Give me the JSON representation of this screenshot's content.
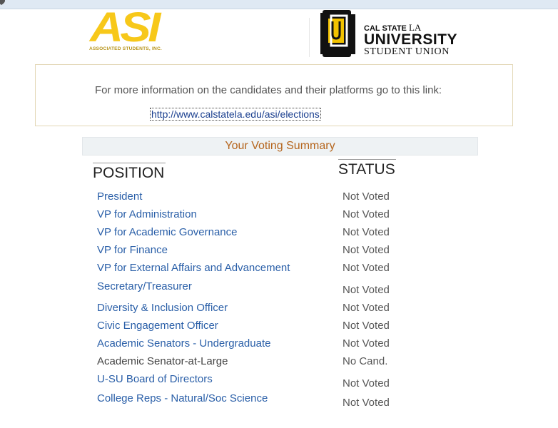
{
  "asi_logo": {
    "letters": "ASI",
    "subtitle": "ASSOCIATED STUDENTS, INC."
  },
  "csula_logo": {
    "line1_bold": "CAL STATE",
    "line1_light": "LA",
    "line2": "UNIVERSITY",
    "line3": "STUDENT UNION"
  },
  "info": {
    "text": "For more information on the candidates and their platforms go to this link:",
    "link": "http://www.calstatela.edu/asi/elections"
  },
  "summary": {
    "title": "Your Voting Summary",
    "position_header": "POSITION",
    "status_header": "STATUS",
    "rows": [
      {
        "position": "President",
        "status": "Not Voted",
        "link": true
      },
      {
        "position": "VP for Administration",
        "status": "Not Voted",
        "link": true
      },
      {
        "position": "VP for Academic Governance",
        "status": "Not Voted",
        "link": true
      },
      {
        "position": "VP for Finance",
        "status": "Not Voted",
        "link": true
      },
      {
        "position": "VP for External Affairs and Advancement",
        "status": "Not Voted",
        "link": true
      },
      {
        "position": "Secretary/Treasurer",
        "status": "Not Voted",
        "link": true
      },
      {
        "position": "Diversity & Inclusion Officer",
        "status": "Not Voted",
        "link": true
      },
      {
        "position": "Civic Engagement Officer",
        "status": "Not Voted",
        "link": true
      },
      {
        "position": "Academic Senators - Undergraduate",
        "status": "Not Voted",
        "link": true
      },
      {
        "position": "Academic Senator-at-Large",
        "status": "No Cand.",
        "link": false
      },
      {
        "position": "U-SU Board of Directors",
        "status": "Not Voted",
        "link": true
      },
      {
        "position": "College Reps - Natural/Soc Science",
        "status": "Not Voted",
        "link": true
      }
    ]
  },
  "colors": {
    "link": "#2a5fa8",
    "summary_title": "#b5651d",
    "asi_yellow": "#f7c81a"
  }
}
